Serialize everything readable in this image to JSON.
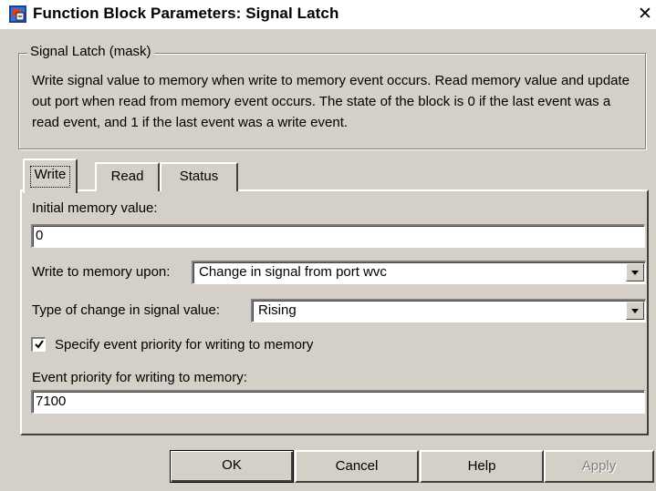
{
  "window": {
    "title": "Function Block Parameters: Signal Latch",
    "close_glyph": "✕"
  },
  "group": {
    "legend": "Signal Latch (mask)",
    "description": "Write signal value to memory when write to memory event occurs. Read memory value and update out port when read from memory event occurs. The state of the block is 0 if the last event was a read event, and 1 if the last event was a write event."
  },
  "tabs": [
    {
      "label": "Write",
      "selected": true
    },
    {
      "label": "Read"
    },
    {
      "label": "Status"
    }
  ],
  "params": {
    "initial_memory_label": "Initial memory value:",
    "initial_memory_value": "0",
    "write_upon_label": "Write to memory upon:",
    "write_upon_value": "Change in signal from port wvc",
    "change_type_label": "Type of change in signal value:",
    "change_type_value": "Rising",
    "specify_priority_label": "Specify event priority for writing to memory",
    "specify_priority_checked": true,
    "priority_label": "Event priority for writing to memory:",
    "priority_value": "7100"
  },
  "buttons": {
    "ok": "OK",
    "cancel": "Cancel",
    "help": "Help",
    "apply": "Apply"
  }
}
